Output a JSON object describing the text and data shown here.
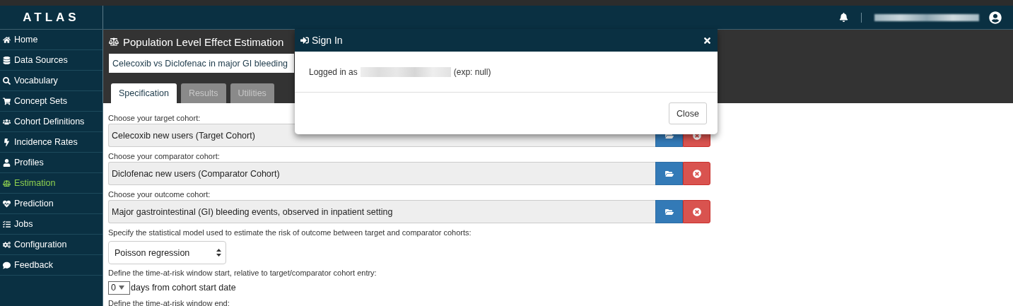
{
  "brand": "ATLAS",
  "sidebar": {
    "items": [
      {
        "label": "Home",
        "selected": false
      },
      {
        "label": "Data Sources",
        "selected": false
      },
      {
        "label": "Vocabulary",
        "selected": false
      },
      {
        "label": "Concept Sets",
        "selected": false
      },
      {
        "label": "Cohort Definitions",
        "selected": false
      },
      {
        "label": "Incidence Rates",
        "selected": false
      },
      {
        "label": "Profiles",
        "selected": false
      },
      {
        "label": "Estimation",
        "selected": true
      },
      {
        "label": "Prediction",
        "selected": false
      },
      {
        "label": "Jobs",
        "selected": false
      },
      {
        "label": "Configuration",
        "selected": false
      },
      {
        "label": "Feedback",
        "selected": false
      }
    ]
  },
  "page": {
    "title": "Population Level Effect Estimation",
    "name_value": "Celecoxib vs Diclofenac in major GI bleeding",
    "tabs": [
      {
        "label": "Specification",
        "selected": true
      },
      {
        "label": "Results",
        "selected": false
      },
      {
        "label": "Utilities",
        "selected": false
      }
    ]
  },
  "form": {
    "cohorts": [
      {
        "label": "Choose your target cohort:",
        "value": "Celecoxib new users (Target Cohort)"
      },
      {
        "label": "Choose your comparator cohort:",
        "value": "Diclofenac new users (Comparator Cohort)"
      },
      {
        "label": "Choose your outcome cohort:",
        "value": "Major gastrointestinal (GI) bleeding events, observed in inpatient setting"
      }
    ],
    "model_label": "Specify the statistical model used to estimate the risk of outcome between target and comparator cohorts:",
    "model_value": "Poisson regression",
    "risk_start_label": "Define the time-at-risk window start, relative to target/comparator cohort entry:",
    "risk_start_days": "0",
    "risk_start_suffix": "days from cohort start date",
    "risk_end_label": "Define the time-at-risk window end:"
  },
  "dialog": {
    "title": "Sign In",
    "message_prefix": "Logged in as",
    "message_suffix": "(exp: null)",
    "close_button": "Close"
  }
}
